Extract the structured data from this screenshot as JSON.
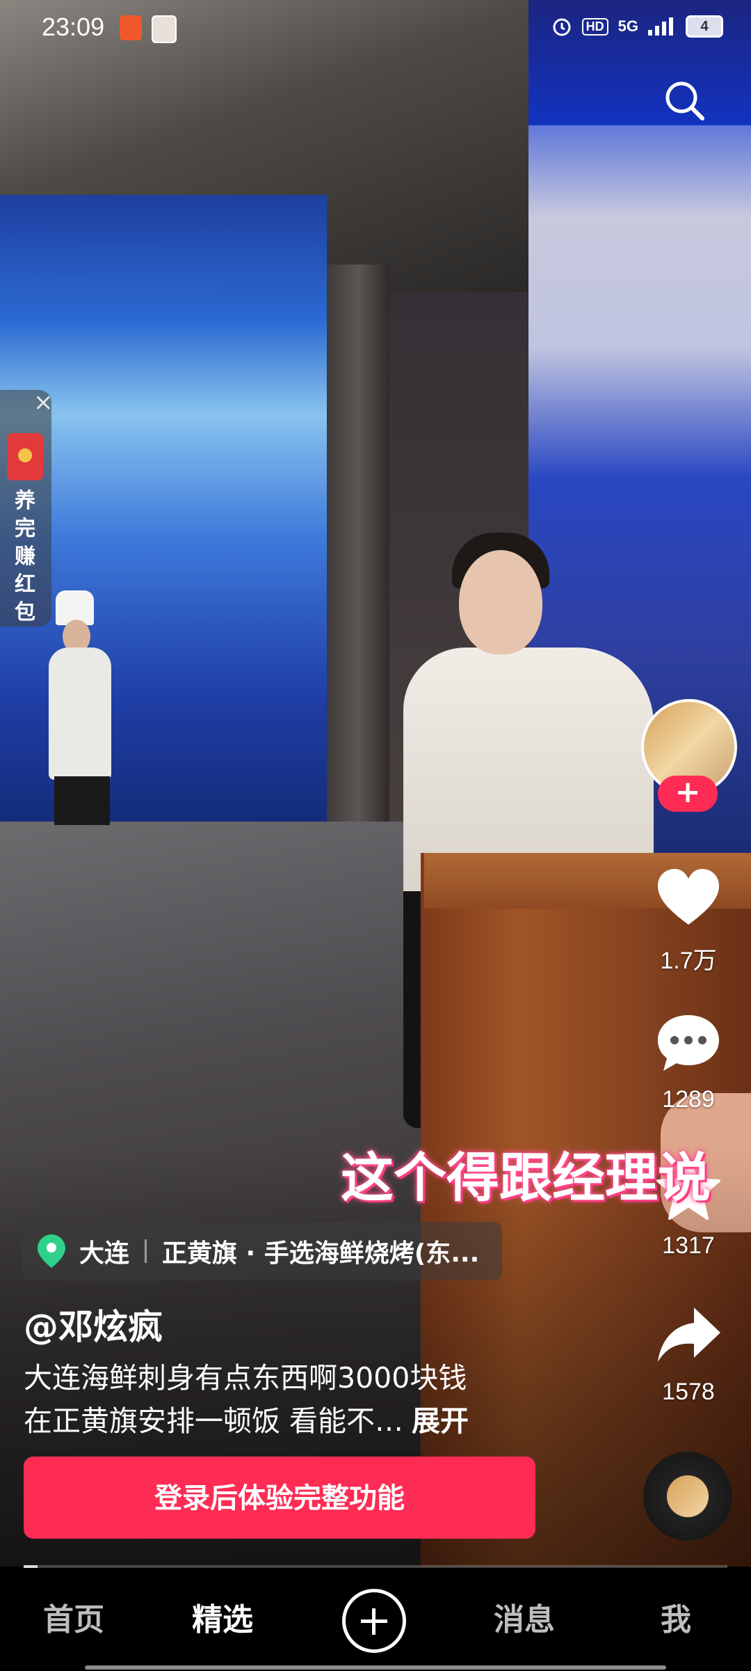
{
  "status_bar": {
    "time": "23:09",
    "network": "5G",
    "hd": "HD",
    "battery": "4"
  },
  "red_packet": {
    "label": "养完赚红包",
    "close": "×"
  },
  "subtitle": "这个得跟经理说",
  "actions": {
    "likes": "1.7万",
    "comments": "1289",
    "favorites": "1317",
    "shares": "1578"
  },
  "location": {
    "city": "大连",
    "place": "正黄旗 · 手选海鲜烧烤(东..."
  },
  "author": "@邓炫疯",
  "description": {
    "line1": "大连海鲜刺身有点东西啊3000块钱",
    "line2": "在正黄旗安排一顿饭 看能不…",
    "more": "展开"
  },
  "login_button": "登录后体验完整功能",
  "nav": {
    "home": "首页",
    "featured": "精选",
    "messages": "消息",
    "me": "我"
  },
  "colors": {
    "accent": "#fe2c55",
    "location_pin": "#2fd18a"
  },
  "icons": [
    "search-icon",
    "heart-icon",
    "comment-icon",
    "star-icon",
    "share-icon",
    "location-pin-icon",
    "plus-icon",
    "music-disc-icon"
  ]
}
